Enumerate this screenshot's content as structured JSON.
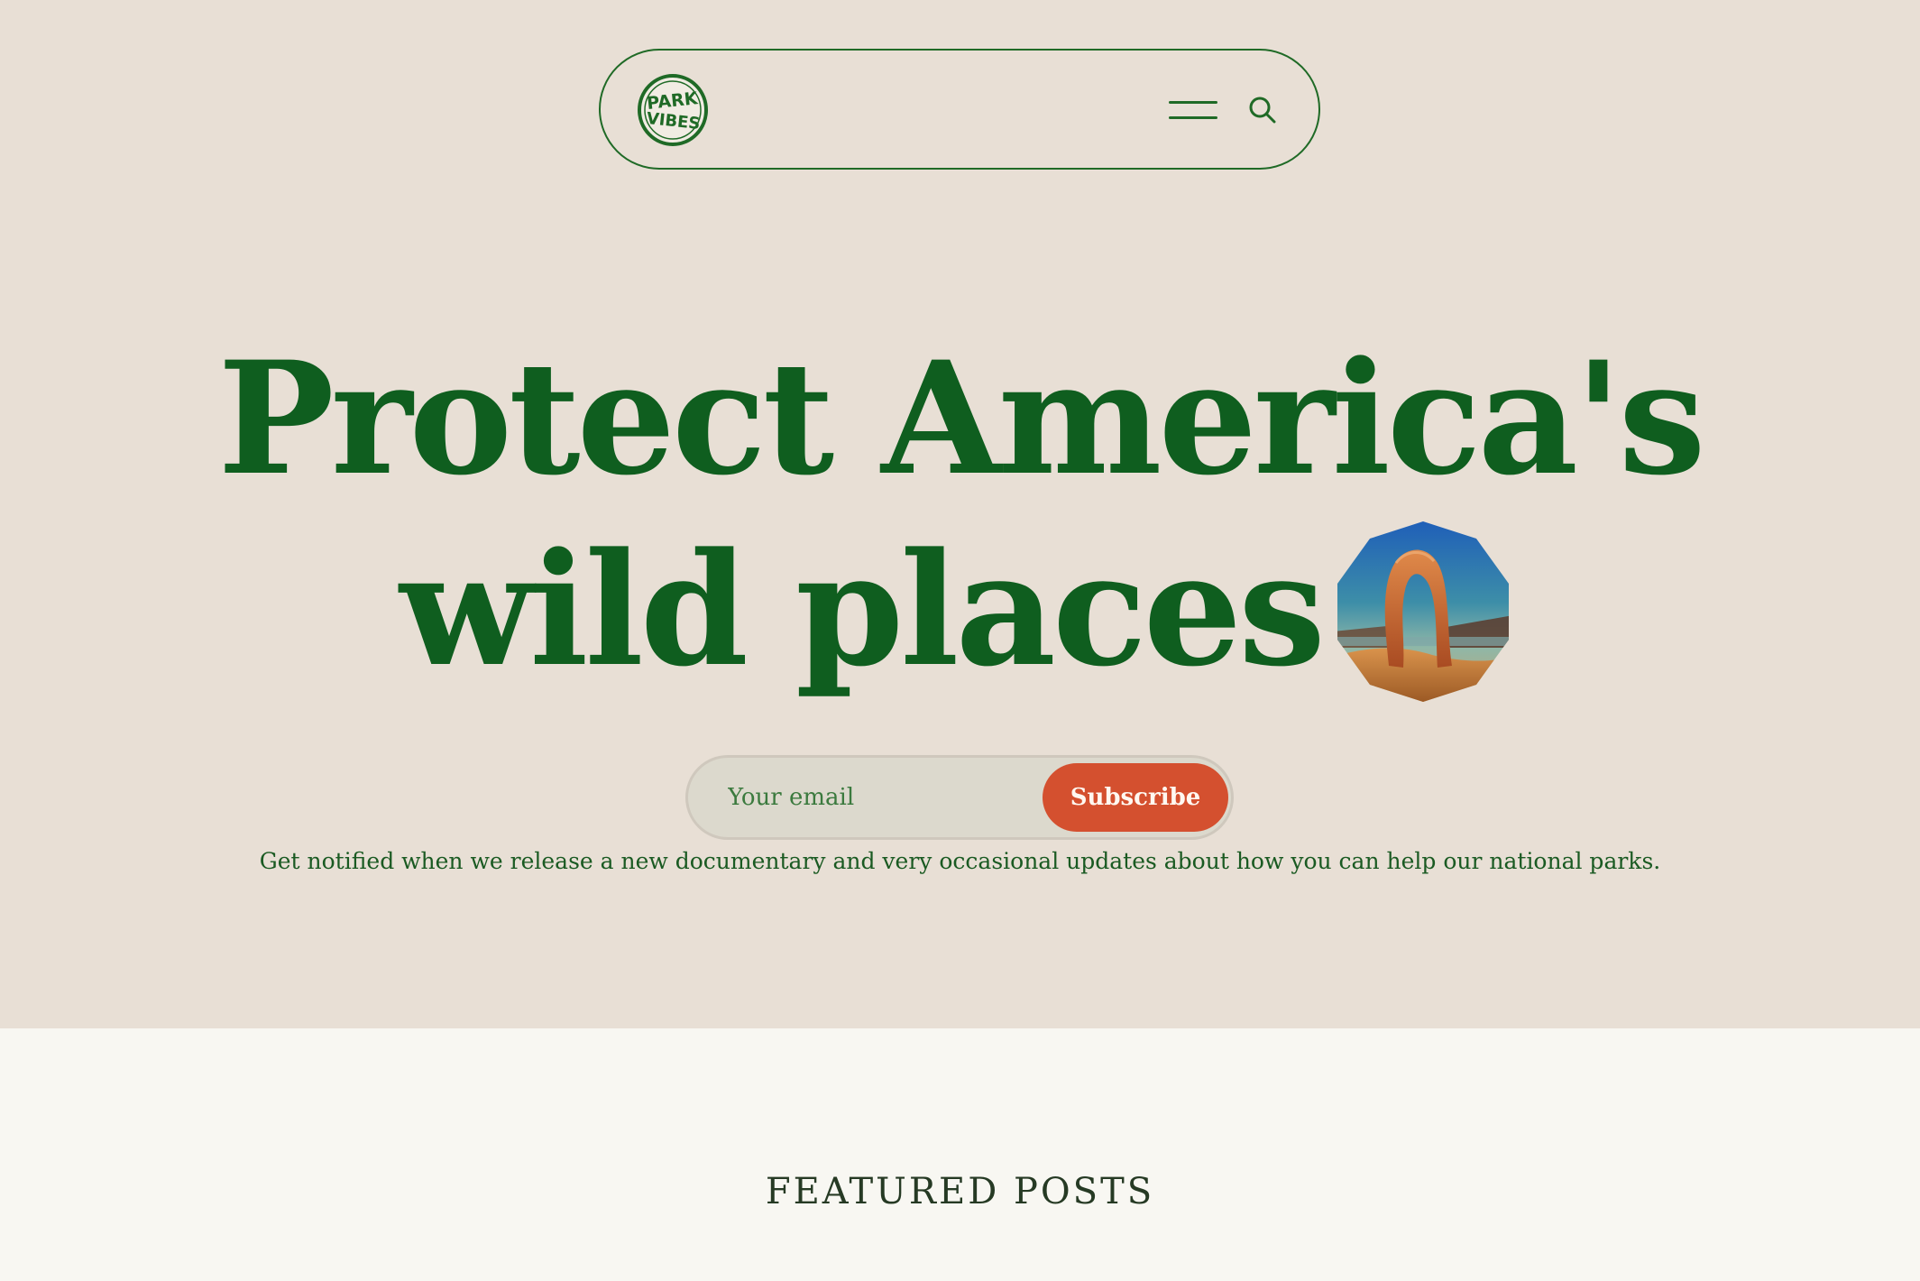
{
  "nav": {
    "logo_alt": "PARK VIBES",
    "menu_icon": "hamburger-menu-icon",
    "search_icon": "search-icon"
  },
  "hero": {
    "headline_line1": "Protect America's",
    "headline_line2": "wild places",
    "image_alt": "Delicate Arch"
  },
  "subscribe": {
    "email_placeholder": "Your email",
    "email_value": "",
    "button_label": "Subscribe"
  },
  "note": "Get notified when we release a new documentary and very occasional updates about how you can help our national parks.",
  "featured": {
    "heading": "FEATURED POSTS"
  },
  "colors": {
    "hero_bg": "#e8dfd5",
    "page_bg": "#f8f7f2",
    "brand_green": "#0f5e1f",
    "accent_orange": "#d4502f"
  }
}
